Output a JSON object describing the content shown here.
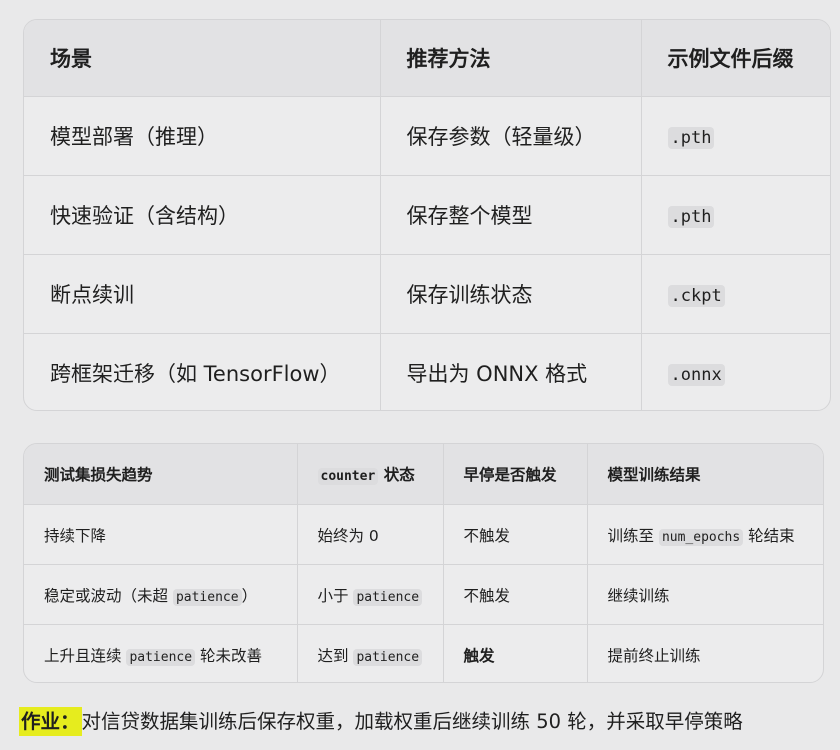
{
  "table1": {
    "headers": [
      "场景",
      "推荐方法",
      "示例文件后缀"
    ],
    "rows": [
      {
        "scene": "模型部署（推理）",
        "method": "保存参数（轻量级）",
        "suffix": ".pth"
      },
      {
        "scene": "快速验证（含结构）",
        "method": "保存整个模型",
        "suffix": ".pth"
      },
      {
        "scene": "断点续训",
        "method": "保存训练状态",
        "suffix": ".ckpt"
      },
      {
        "scene": "跨框架迁移（如 TensorFlow）",
        "method": "导出为 ONNX 格式",
        "suffix": ".onnx"
      }
    ]
  },
  "table2": {
    "headers": {
      "trend": "测试集损失趋势",
      "counter_code": "counter",
      "counter_text": " 状态",
      "stop": "早停是否触发",
      "result": "模型训练结果"
    },
    "rows": [
      {
        "trend": "持续下降",
        "counter": "始终为 0",
        "stop": "不触发",
        "result_pre": "训练至 ",
        "result_code": "num_epochs",
        "result_post": " 轮结束"
      },
      {
        "trend_pre": "稳定或波动（未超 ",
        "trend_code": "patience",
        "trend_post": "）",
        "counter_pre": "小于 ",
        "counter_code": "patience",
        "stop": "不触发",
        "result": "继续训练"
      },
      {
        "trend_pre": "上升且连续 ",
        "trend_code": "patience",
        "trend_post": " 轮未改善",
        "counter_pre": "达到 ",
        "counter_code": "patience",
        "stop": "触发",
        "result": "提前终止训练"
      }
    ]
  },
  "homework": {
    "label": "作业：",
    "text": "对信贷数据集训练后保存权重，加载权重后继续训练 50 轮，并采取早停策略",
    "highlight_color": "#e6ec1e"
  }
}
